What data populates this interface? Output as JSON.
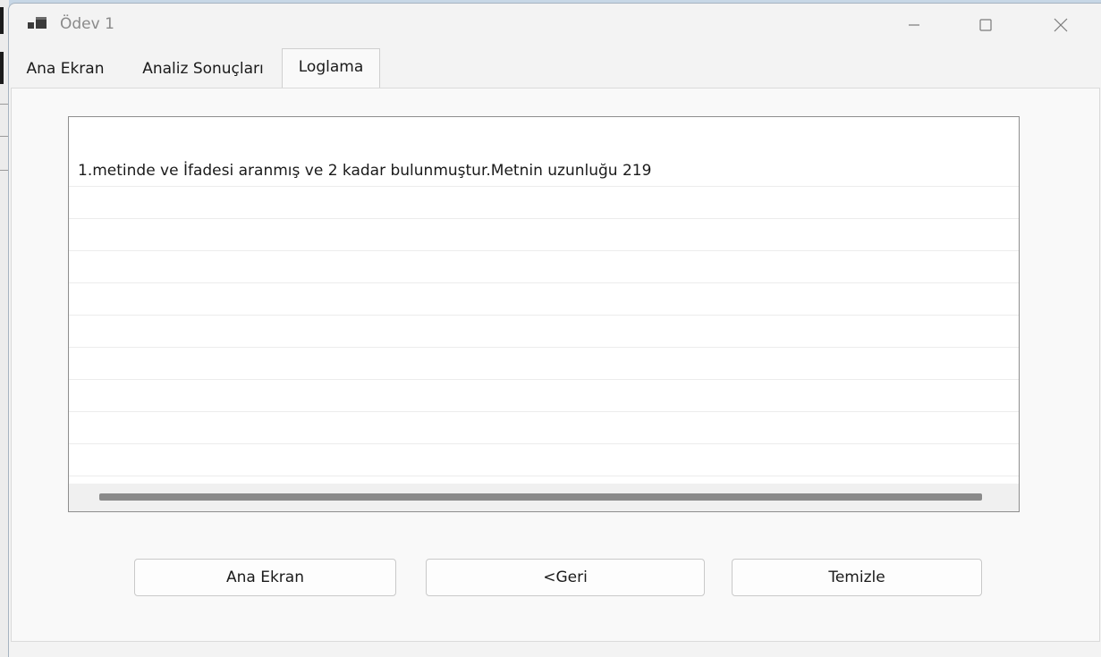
{
  "window": {
    "title": "Ödev 1",
    "accent": "#2b6cb0"
  },
  "tabs": [
    {
      "label": "Ana Ekran",
      "active": false
    },
    {
      "label": "Analiz Sonuçları",
      "active": false
    },
    {
      "label": "Loglama",
      "active": true
    }
  ],
  "log": {
    "items": [
      "1.metinde ve İfadesi aranmış ve 2 kadar bulunmuştur.Metnin uzunluğu 219",
      "",
      "",
      "",
      "",
      "",
      "",
      "",
      "",
      ""
    ]
  },
  "buttons": {
    "home_label": "Ana Ekran",
    "back_label": "<Geri",
    "clear_label": "Temizle"
  },
  "icons": {
    "app": "app-icon",
    "minimize": "minimize-icon",
    "maximize": "maximize-icon",
    "close": "close-icon"
  }
}
